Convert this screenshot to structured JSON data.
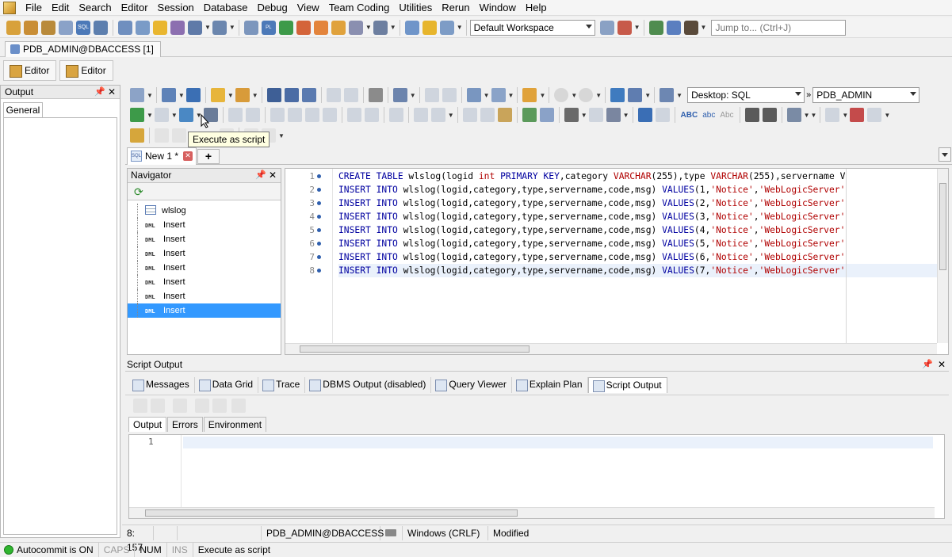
{
  "menu": [
    "File",
    "Edit",
    "Search",
    "Editor",
    "Session",
    "Database",
    "Debug",
    "View",
    "Team Coding",
    "Utilities",
    "Rerun",
    "Window",
    "Help"
  ],
  "toolbar": {
    "workspace": "Default Workspace",
    "jump_placeholder": "Jump to... (Ctrl+J)"
  },
  "connection_tab": "PDB_ADMIN@DBACCESS [1]",
  "editor_buttons": [
    "Editor",
    "Editor"
  ],
  "output_panel": {
    "title": "Output",
    "tab": "General"
  },
  "worksheet": {
    "desktop_combo": "Desktop: SQL",
    "schema_combo": "PDB_ADMIN",
    "tooltip": "Execute as script",
    "tab_label": "New 1 *"
  },
  "navigator": {
    "title": "Navigator",
    "items": [
      {
        "tag": "",
        "label": "wlslog"
      },
      {
        "tag": "DML",
        "label": "Insert"
      },
      {
        "tag": "DML",
        "label": "Insert"
      },
      {
        "tag": "DML",
        "label": "Insert"
      },
      {
        "tag": "DML",
        "label": "Insert"
      },
      {
        "tag": "DML",
        "label": "Insert"
      },
      {
        "tag": "DML",
        "label": "Insert"
      },
      {
        "tag": "DML",
        "label": "Insert"
      }
    ]
  },
  "code_lines": [
    {
      "n": "1",
      "html": "<span class='kw'>CREATE TABLE</span> wlslog(logid <span class='typ'>int</span> <span class='kw'>PRIMARY KEY</span>,category <span class='typ'>VARCHAR</span>(255),type <span class='typ'>VARCHAR</span>(255),servername V"
    },
    {
      "n": "2",
      "html": "<span class='kw'>INSERT INTO</span> wlslog(logid,category,type,servername,code,msg) <span class='kw'>VALUES</span>(1,<span class='str'>'Notice'</span>,<span class='str'>'WebLogicServer'</span>"
    },
    {
      "n": "3",
      "html": "<span class='kw'>INSERT INTO</span> wlslog(logid,category,type,servername,code,msg) <span class='kw'>VALUES</span>(2,<span class='str'>'Notice'</span>,<span class='str'>'WebLogicServer'</span>"
    },
    {
      "n": "4",
      "html": "<span class='kw'>INSERT INTO</span> wlslog(logid,category,type,servername,code,msg) <span class='kw'>VALUES</span>(3,<span class='str'>'Notice'</span>,<span class='str'>'WebLogicServer'</span>"
    },
    {
      "n": "5",
      "html": "<span class='kw'>INSERT INTO</span> wlslog(logid,category,type,servername,code,msg) <span class='kw'>VALUES</span>(4,<span class='str'>'Notice'</span>,<span class='str'>'WebLogicServer'</span>"
    },
    {
      "n": "6",
      "html": "<span class='kw'>INSERT INTO</span> wlslog(logid,category,type,servername,code,msg) <span class='kw'>VALUES</span>(5,<span class='str'>'Notice'</span>,<span class='str'>'WebLogicServer'</span>"
    },
    {
      "n": "7",
      "html": "<span class='kw'>INSERT INTO</span> wlslog(logid,category,type,servername,code,msg) <span class='kw'>VALUES</span>(6,<span class='str'>'Notice'</span>,<span class='str'>'WebLogicServer'</span>"
    },
    {
      "n": "8",
      "html": "<span class='kw'>INSERT INTO</span> wlslog(logid,category,type,servername,code,msg) <span class='kw'>VALUES</span>(7,<span class='str'>'Notice'</span>,<span class='str'>'WebLogicServer'</span>"
    }
  ],
  "script_output": {
    "title": "Script Output",
    "tabs": [
      "Messages",
      "Data Grid",
      "Trace",
      "DBMS Output (disabled)",
      "Query Viewer",
      "Explain Plan",
      "Script Output"
    ],
    "subtabs": [
      "Output",
      "Errors",
      "Environment"
    ],
    "line1": "1"
  },
  "status": {
    "position": "8: 157",
    "connection": "PDB_ADMIN@DBACCESS",
    "line_ending": "Windows (CRLF)",
    "state": "Modified",
    "autocommit": "Autocommit is ON",
    "caps": "CAPS",
    "num": "NUM",
    "ins": "INS",
    "message": "Execute as script"
  }
}
